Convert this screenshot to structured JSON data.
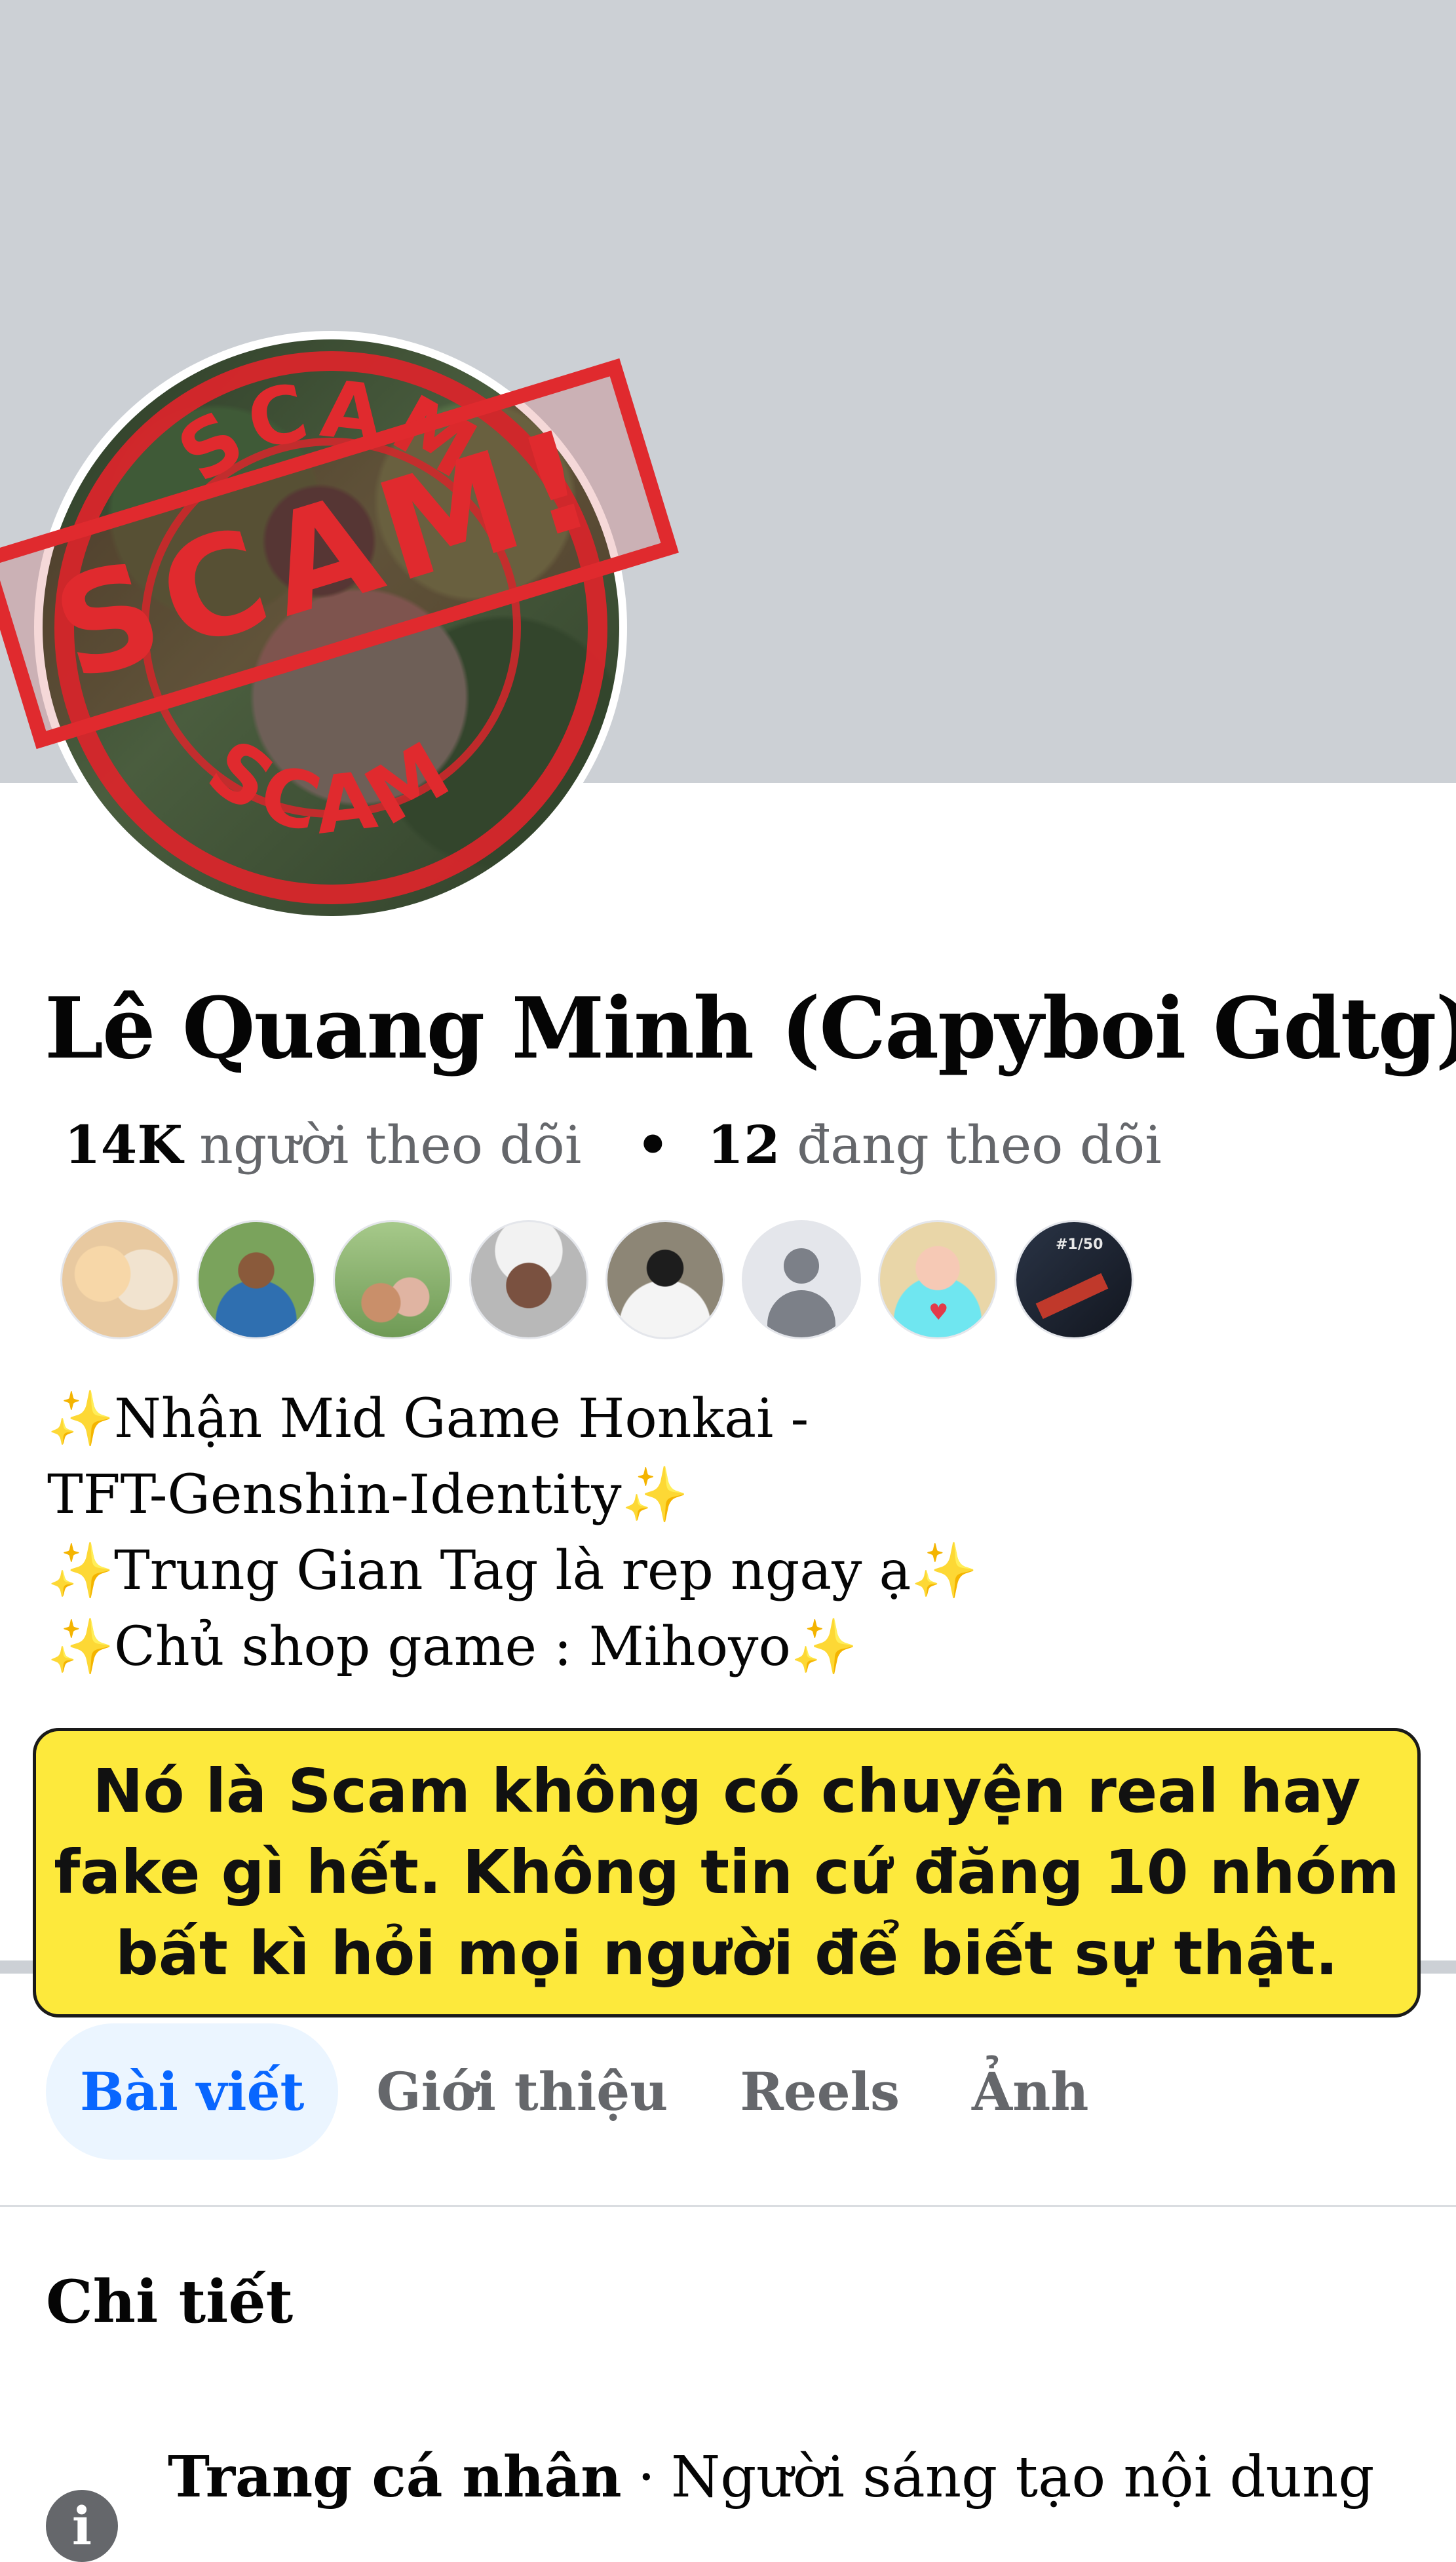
{
  "profile": {
    "name": "Lê Quang Minh (Capyboi Gdtg)",
    "followers_count": "14K",
    "followers_label": "người theo dõi",
    "separator": "•",
    "following_count": "12",
    "following_label": "đang theo dõi"
  },
  "stamp": {
    "top_text": "SCAM",
    "banner_text": "SCAM!",
    "bottom_text": "SCAM",
    "color": "#d8262b"
  },
  "friends": {
    "count_shown": 8,
    "f8_overlay": "#1/50"
  },
  "bio": {
    "lines": [
      "✨Nhận Mid Game Honkai -",
      "TFT-Genshin-Identity✨",
      "✨Trung Gian Tag là rep ngay ạ✨",
      "✨Chủ shop game : Mihoyo✨"
    ]
  },
  "warning": {
    "lines": [
      "Nó là Scam không có chuyện real hay",
      "fake gì hết. Không tin cứ đăng 10 nhóm",
      "bất kì hỏi mọi người để biết sự thật."
    ],
    "background": "#fde93c"
  },
  "tabs": {
    "items": [
      {
        "label": "Bài viết",
        "active": true
      },
      {
        "label": "Giới thiệu",
        "active": false
      },
      {
        "label": "Reels",
        "active": false
      },
      {
        "label": "Ảnh",
        "active": false
      }
    ],
    "active_color": "#0866ff"
  },
  "details": {
    "title": "Chi tiết",
    "row": {
      "type": "Trang cá nhân",
      "separator": "·",
      "category": "Người sáng tạo nội dung",
      "icon": "info-icon",
      "icon_glyph": "i"
    }
  }
}
